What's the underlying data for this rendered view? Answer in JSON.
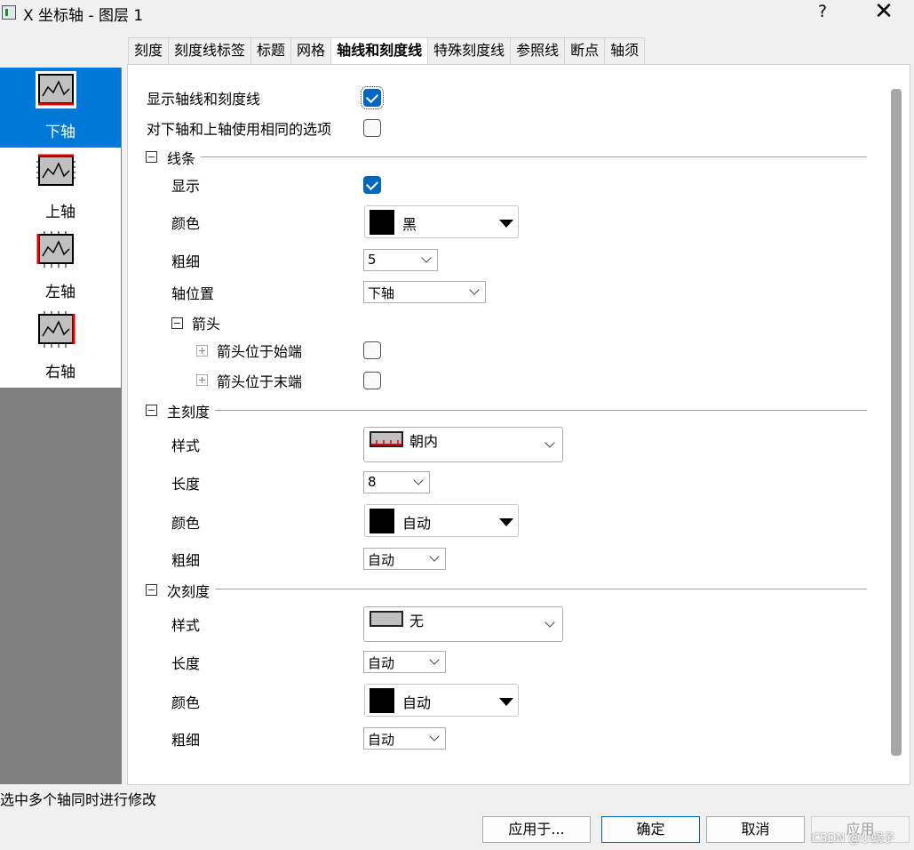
{
  "window": {
    "title": "X 坐标轴 - 图层 1",
    "help": "?",
    "close": "✕"
  },
  "tabs": [
    "刻度",
    "刻度线标签",
    "标题",
    "网格",
    "轴线和刻度线",
    "特殊刻度线",
    "参照线",
    "断点",
    "轴须"
  ],
  "active_tab": "轴线和刻度线",
  "axes": [
    {
      "label": "下轴",
      "selected": true
    },
    {
      "label": "上轴",
      "selected": false
    },
    {
      "label": "左轴",
      "selected": false
    },
    {
      "label": "右轴",
      "selected": false
    }
  ],
  "general": {
    "show_axis_ticks": {
      "label": "显示轴线和刻度线",
      "checked": true
    },
    "same_options": {
      "label": "对下轴和上轴使用相同的选项",
      "checked": false
    }
  },
  "line": {
    "header": "线条",
    "show": {
      "label": "显示",
      "checked": true
    },
    "color": {
      "label": "颜色",
      "value": "黑",
      "swatch": "#000000"
    },
    "thickness": {
      "label": "粗细",
      "value": "5"
    },
    "axis_position": {
      "label": "轴位置",
      "value": "下轴"
    },
    "arrow": {
      "header": "箭头",
      "start": {
        "label": "箭头位于始端",
        "checked": false
      },
      "end": {
        "label": "箭头位于末端",
        "checked": false
      }
    }
  },
  "major_ticks": {
    "header": "主刻度",
    "style": {
      "label": "样式",
      "value": "朝内"
    },
    "length": {
      "label": "长度",
      "value": "8"
    },
    "color": {
      "label": "颜色",
      "value": "自动",
      "swatch": "#000000"
    },
    "thickness": {
      "label": "粗细",
      "value": "自动"
    }
  },
  "minor_ticks": {
    "header": "次刻度",
    "style": {
      "label": "样式",
      "value": "无"
    },
    "length": {
      "label": "长度",
      "value": "自动"
    },
    "color": {
      "label": "颜色",
      "value": "自动",
      "swatch": "#000000"
    },
    "thickness": {
      "label": "粗细",
      "value": "自动"
    }
  },
  "status": "选中多个轴同时进行修改",
  "buttons": {
    "apply_to": "应用于...",
    "ok": "确定",
    "cancel": "取消",
    "apply": "应用"
  },
  "watermark": "CSDN @小蜗子",
  "colors": {
    "accent": "#0078d7",
    "checkbox": "#0067c0",
    "list_bg": "#808080",
    "axis_red": "#e00000"
  }
}
